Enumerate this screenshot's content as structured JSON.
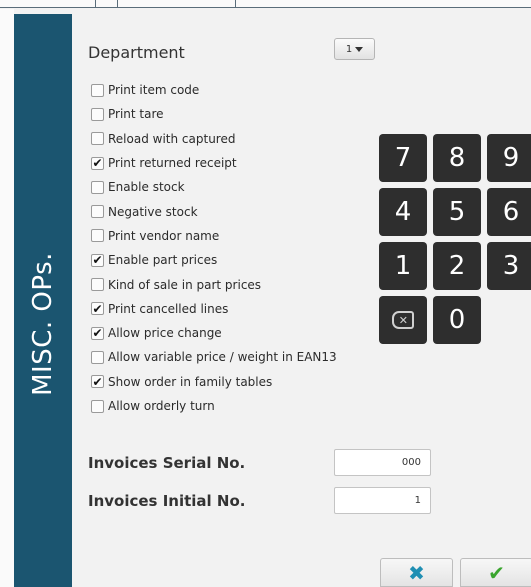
{
  "panel": {
    "title": "MISC. OPs."
  },
  "department": {
    "label": "Department",
    "value": "1"
  },
  "options": [
    {
      "label": "Print item code",
      "checked": false
    },
    {
      "label": "Print tare",
      "checked": false
    },
    {
      "label": "Reload with captured",
      "checked": false
    },
    {
      "label": "Print returned receipt",
      "checked": true
    },
    {
      "label": "Enable stock",
      "checked": false
    },
    {
      "label": "Negative stock",
      "checked": false
    },
    {
      "label": "Print vendor name",
      "checked": false
    },
    {
      "label": "Enable part prices",
      "checked": true
    },
    {
      "label": "Kind of sale in part prices",
      "checked": false
    },
    {
      "label": "Print cancelled lines",
      "checked": true
    },
    {
      "label": "Allow price change",
      "checked": true
    },
    {
      "label": "Allow variable price / weight in EAN13",
      "checked": false
    },
    {
      "label": "Show order in family tables",
      "checked": true
    },
    {
      "label": "Allow orderly turn",
      "checked": false
    }
  ],
  "keypad": {
    "keys": [
      "7",
      "8",
      "9",
      "4",
      "5",
      "6",
      "1",
      "2",
      "3"
    ],
    "zero": "0",
    "backspace_icon": "backspace-icon",
    "key_color": "#2e2e2e"
  },
  "invoice_serial": {
    "label": "Invoices Serial No.",
    "value": "000"
  },
  "invoice_initial": {
    "label": "Invoices Initial No.",
    "value": "1"
  },
  "actions": {
    "cancel_icon": "✖",
    "cancel_color": "#1f8fb3",
    "confirm_icon": "✔",
    "confirm_color": "#3aa52e"
  },
  "colors": {
    "sidebar": "#1b5570",
    "background": "#f2f2f2"
  }
}
